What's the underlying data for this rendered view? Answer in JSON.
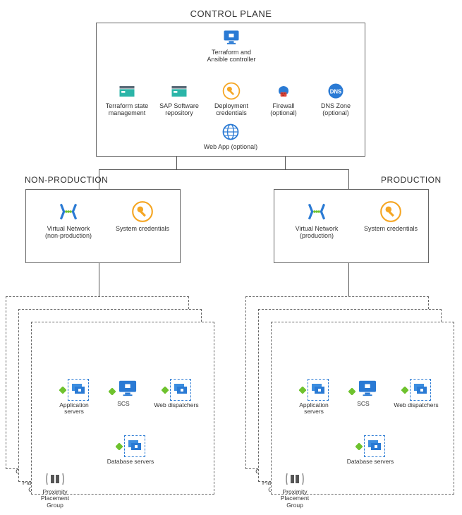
{
  "title_control_plane": "CONTROL PLANE",
  "title_nonprod": "NON-PRODUCTION",
  "title_prod": "PRODUCTION",
  "control_plane": {
    "terraform_controller": "Terraform and Ansible controller",
    "terraform_state": "Terraform state management",
    "sap_repo": "SAP Software repository",
    "deploy_creds": "Deployment credentials",
    "firewall": "Firewall (optional)",
    "dns": "DNS Zone (optional)",
    "webapp": "Web App (optional)"
  },
  "workload": {
    "vnet_nonprod": "Virtual Network (non-production)",
    "vnet_prod": "Virtual Network (production)",
    "sys_creds": "System credentials"
  },
  "system": {
    "app_servers": "Application servers",
    "scs": "SCS",
    "web_dispatchers": "Web dispatchers",
    "db_servers": "Database servers",
    "ppg": "Proximity Placement Group"
  },
  "colors": {
    "azure_blue": "#2a7ad4",
    "teal": "#2bb5a8",
    "orange": "#f5a623",
    "red": "#e34b3d",
    "green": "#6ec22e"
  }
}
